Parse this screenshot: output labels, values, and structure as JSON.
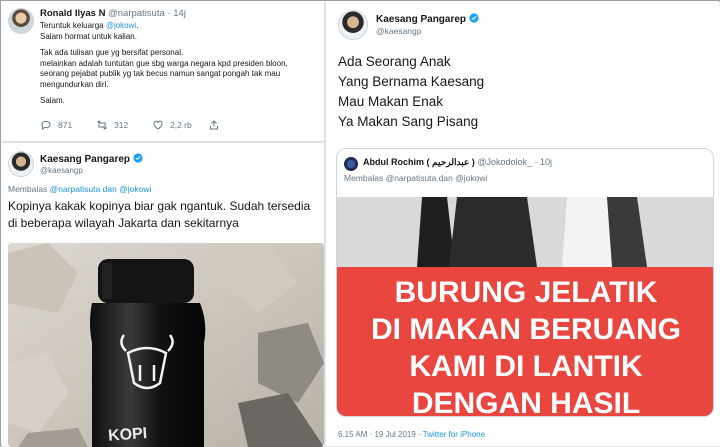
{
  "tweet_top_left": {
    "name": "Ronald Ilyas N",
    "handle": "@narpatisuta · 14j",
    "line1_prefix": "Teruntuk keluarga ",
    "line1_mention": "@jokowi",
    "line1_suffix": ".",
    "line2": "Salam hormat untuk kalian.",
    "para2": "Tak ada tulisan gue yg bersifat personal.\nmelainkan adalah tuntutan gue sbg warga negara kpd presiden bloon,\nseorang pejabat publik yg tak becus namun sangat pongah tak mau\nmengundurkan diri.",
    "para3": "Salam.",
    "reply_count": "871",
    "retweet_count": "312",
    "like_count": "2,2 rb"
  },
  "tweet_bottom_left": {
    "name": "Kaesang Pangarep",
    "handle": "@kaesangp",
    "reply_prefix": "Membalas ",
    "reply_mentions": "@narpatisuta dan @jokowi",
    "text": "Kopinya kakak kopinya biar gak ngantuk. Sudah tersedia di beberapa wilayah Jakarta dan sekitarnya",
    "bottle_label": "KOPI"
  },
  "tweet_right": {
    "name": "Kaesang Pangarep",
    "handle": "@kaesangp",
    "poem": [
      "Ada Seorang Anak",
      "Yang Bernama Kaesang",
      "Mau Makan Enak",
      "Ya Makan Sang Pisang"
    ],
    "quoted": {
      "name": "Abdul Rochim ( عبدالرحيم )",
      "handle": "@Jokodolok_ · 10j",
      "reply": "Membalas @narpatisuta dan @jokowi",
      "image_lines": [
        "BURUNG JELATIK",
        "DI MAKAN BERUANG",
        "KAMI DI LANTIK",
        "DENGAN HASIL"
      ]
    },
    "timestamp": "6.15 AM · 19 Jul 2019 · ",
    "source": "Twitter for iPhone"
  },
  "colors": {
    "link": "#1b95e0",
    "muted": "#657786",
    "verified": "#1da1f2",
    "banner_red": "#e8463f"
  }
}
